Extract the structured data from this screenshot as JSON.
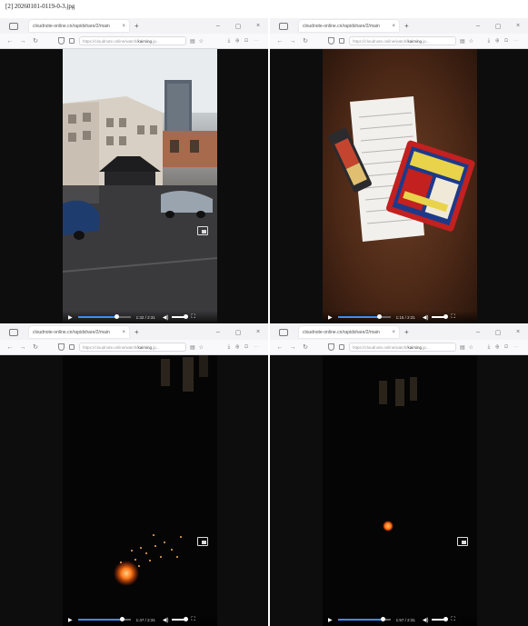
{
  "document": {
    "title": "[2] 20260101-0119-0-3.jpg"
  },
  "browser": {
    "url_host": "kaiming",
    "window_controls": [
      "–",
      "▢",
      "×"
    ]
  },
  "panels": [
    {
      "tab_title": "cloudnote-online.cn/rapidshare/2/main",
      "url_prefix": "https://cloudnote.online/watch/",
      "url_suffix": ".jp...",
      "time": "1:32 / 2:31",
      "progress": 0.72,
      "scene": "street"
    },
    {
      "tab_title": "cloudnote-online.cn/rapidshare/2/main",
      "url_prefix": "https://cloudnote.online/watch/",
      "url_suffix": ".jp...",
      "time": "1:15 / 2:31",
      "progress": 0.78,
      "scene": "table"
    },
    {
      "tab_title": "cloudnote-online.cn/rapidshare/2/main",
      "url_prefix": "https://cloudnote.online/watch/",
      "url_suffix": ".jp...",
      "time": "1:47 / 2:31",
      "progress": 0.82,
      "scene": "sparks"
    },
    {
      "tab_title": "cloudnote-online.cn/rapidshare/2/main",
      "url_prefix": "https://cloudnote.online/watch/",
      "url_suffix": ".jp...",
      "time": "1:57 / 2:31",
      "progress": 0.85,
      "scene": "ember"
    }
  ],
  "icons": {
    "tab": "browser-tab-icon",
    "back": "back-arrow-icon",
    "forward": "forward-arrow-icon",
    "reload": "reload-icon",
    "shield": "shield-icon",
    "lock": "lock-icon",
    "pip": "picture-in-picture-icon",
    "play": "play-icon",
    "volume": "volume-icon",
    "fullscreen": "fullscreen-icon"
  },
  "colors": {
    "progress": "#3a8ef6"
  }
}
